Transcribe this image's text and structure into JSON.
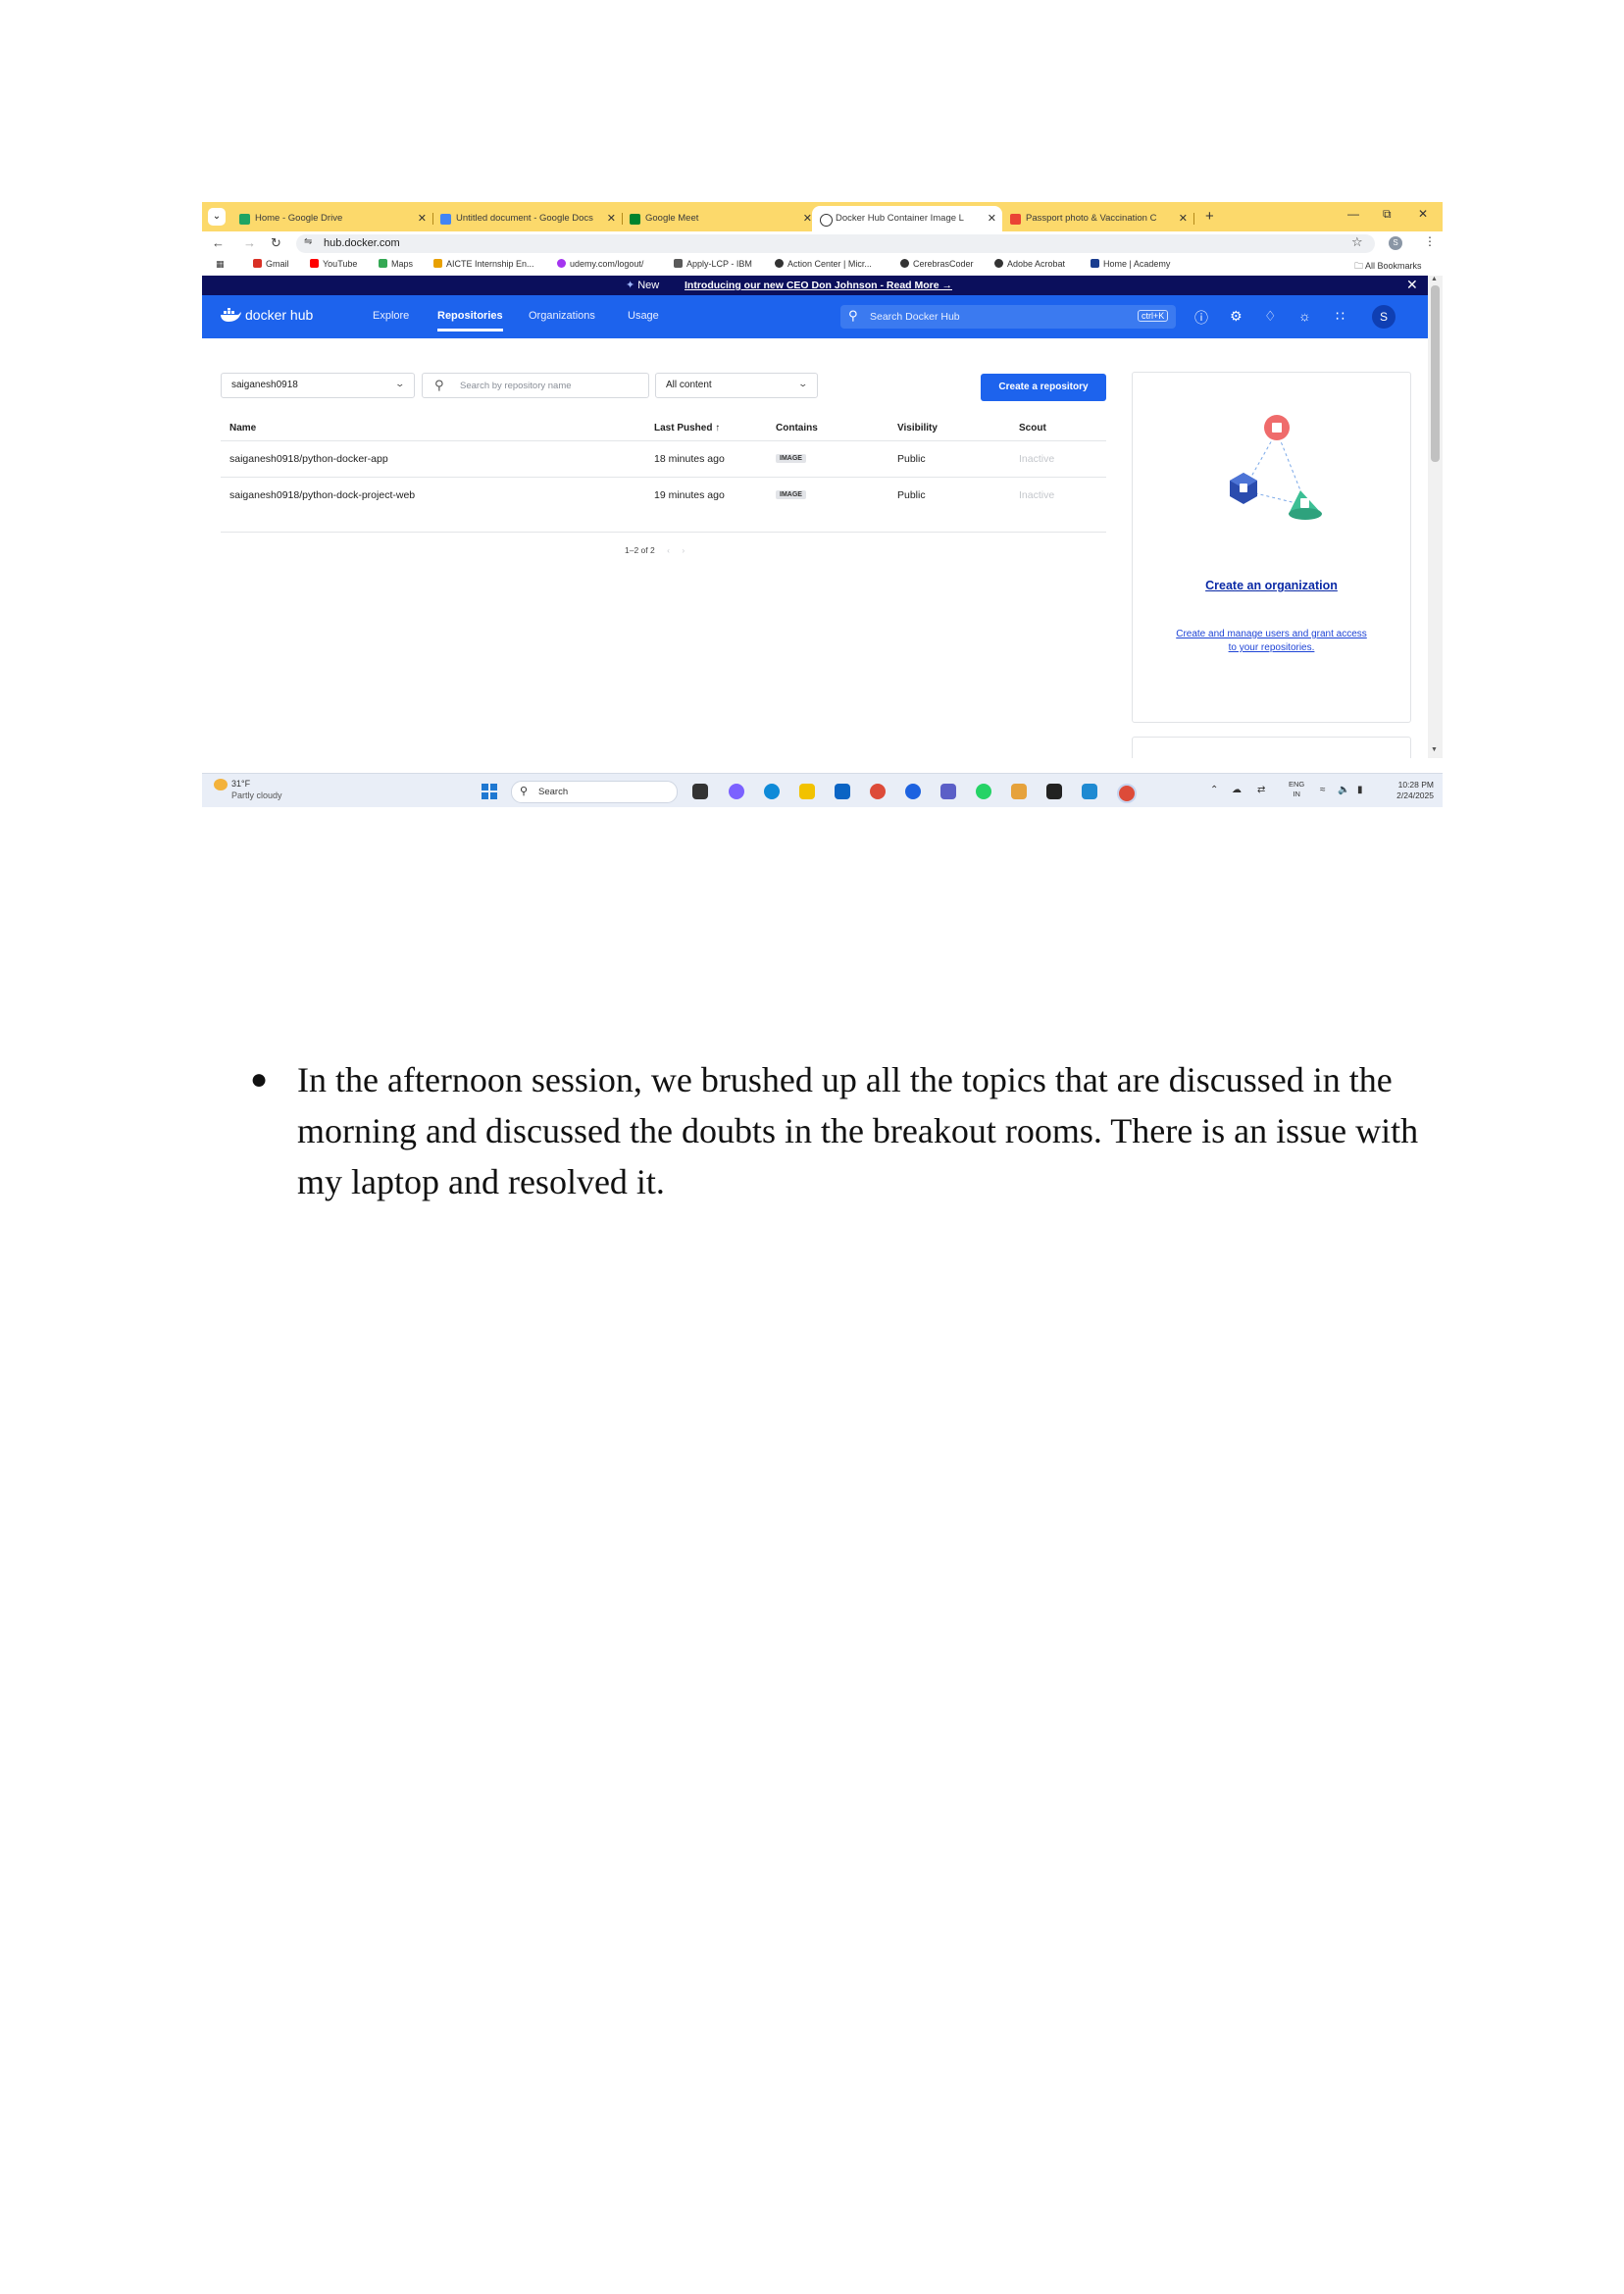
{
  "browser": {
    "tabs": [
      {
        "label": "Home - Google Drive",
        "active": false
      },
      {
        "label": "Untitled document - Google Docs",
        "active": false
      },
      {
        "label": "Google Meet",
        "active": false
      },
      {
        "label": "Docker Hub Container Image L",
        "active": true
      },
      {
        "label": "Passport photo & Vaccination C",
        "active": false
      }
    ],
    "new_tab_icon": "+",
    "window_controls": [
      "minimize-icon",
      "restore-icon",
      "close-icon"
    ],
    "url": "hub.docker.com",
    "profile_initial": "S",
    "bookmarks": [
      {
        "label": "Gmail",
        "color": "#d93025"
      },
      {
        "label": "YouTube",
        "color": "#ff0000"
      },
      {
        "label": "Maps",
        "color": "#34a853"
      },
      {
        "label": "AICTE Internship En...",
        "color": "#e8a000"
      },
      {
        "label": "udemy.com/logout/",
        "color": "#a435f0"
      },
      {
        "label": "Apply-LCP - IBM",
        "color": "#5a5a5a"
      },
      {
        "label": "Action Center | Micr...",
        "color": "#333333"
      },
      {
        "label": "CerebrasCoder",
        "color": "#333333"
      },
      {
        "label": "Adobe Acrobat",
        "color": "#333333"
      },
      {
        "label": "Home | Academy",
        "color": "#1a3d8f"
      }
    ],
    "all_bookmarks": "All Bookmarks"
  },
  "dockerhub": {
    "banner_new": "New",
    "banner_message": "Introducing our new CEO Don Johnson - Read More →",
    "logo_text": "docker hub",
    "nav": [
      "Explore",
      "Repositories",
      "Organizations",
      "Usage"
    ],
    "active_nav": "Repositories",
    "search_placeholder": "Search Docker Hub",
    "search_shortcut": "ctrl+K",
    "avatar_initial": "S",
    "namespace_select": "saiganesh0918",
    "repo_search_placeholder": "Search by repository name",
    "content_filter": "All content",
    "create_button": "Create a repository",
    "table": {
      "columns": [
        "Name",
        "Last Pushed ↑",
        "Contains",
        "Visibility",
        "Scout"
      ],
      "rows": [
        {
          "name": "saiganesh0918/python-docker-app",
          "last_pushed": "18 minutes ago",
          "contains": "IMAGE",
          "visibility": "Public",
          "scout": "Inactive"
        },
        {
          "name": "saiganesh0918/python-dock-project-web",
          "last_pushed": "19 minutes ago",
          "contains": "IMAGE",
          "visibility": "Public",
          "scout": "Inactive"
        }
      ],
      "pagination": "1–2 of 2"
    },
    "org_card": {
      "title": "Create an organization",
      "description": "Create and manage users and grant access to your repositories."
    }
  },
  "taskbar": {
    "temperature": "31°F",
    "weather": "Partly cloudy",
    "search_placeholder": "Search",
    "language": "ENG",
    "region": "IN",
    "time": "10:28 PM",
    "date": "2/24/2025"
  },
  "document": {
    "bullet": "In the afternoon session, we brushed up all the topics that are discussed in the morning and discussed the doubts in the breakout rooms. There is an issue with my laptop and resolved it."
  }
}
